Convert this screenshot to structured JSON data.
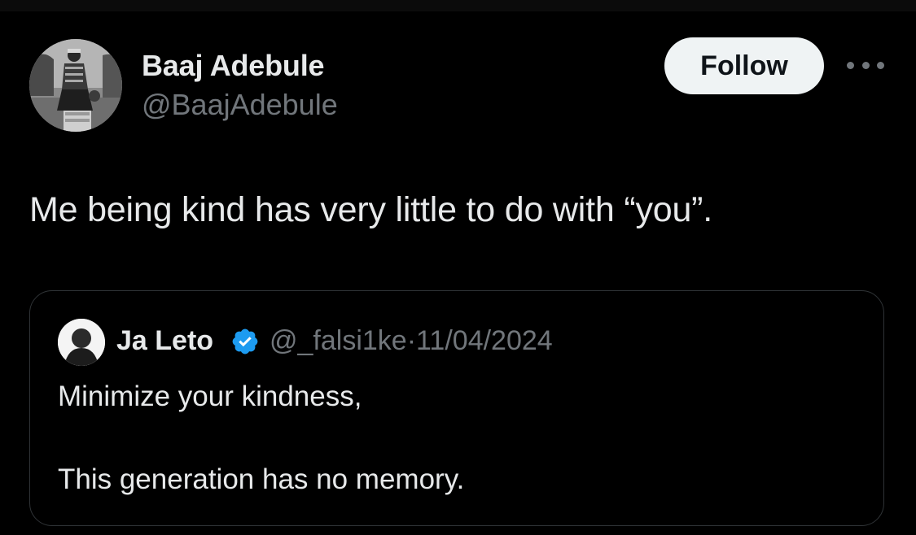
{
  "tweet": {
    "author": {
      "name": "Baaj Adebule",
      "handle": "@BaajAdebule",
      "avatar": "profile-photo"
    },
    "follow_label": "Follow",
    "more_icon": "more-horizontal-icon",
    "text": "Me being kind has very little to do with “you”."
  },
  "quote": {
    "author": {
      "name": "Ja Leto",
      "verified": true,
      "verified_color": "#1d9bf0",
      "handle": "@_falsi1ke",
      "separator": "·",
      "date": "11/04/2024"
    },
    "lines": [
      "Minimize your kindness,",
      "This generation has no memory."
    ]
  },
  "colors": {
    "background": "#000000",
    "primary_text": "#e7e9ea",
    "secondary_text": "#71767b",
    "follow_button_bg": "#eff3f4",
    "border": "#2f3336"
  }
}
